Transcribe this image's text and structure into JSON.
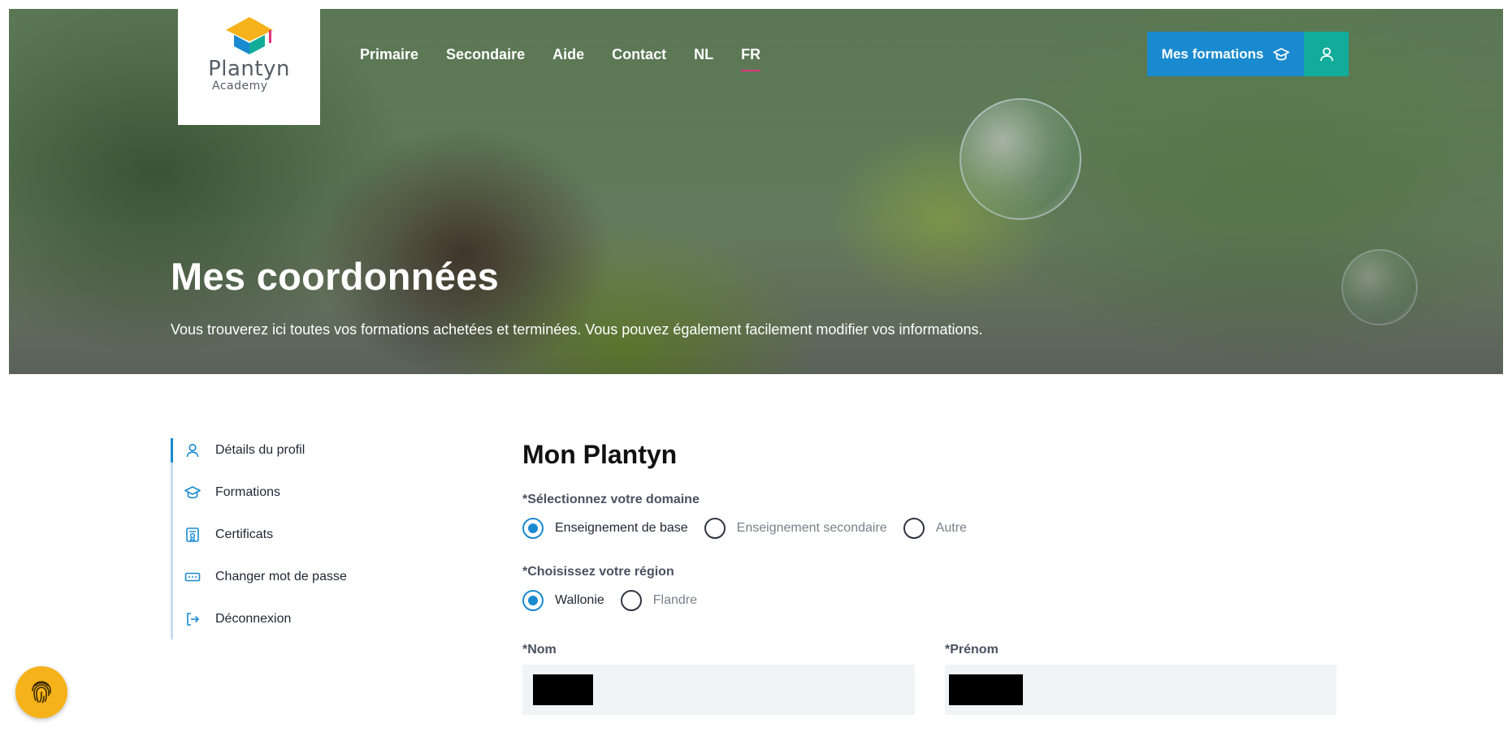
{
  "header": {
    "logo_name": "Plantyn",
    "logo_sub": "Academy",
    "nav": [
      {
        "label": "Primaire"
      },
      {
        "label": "Secondaire"
      },
      {
        "label": "Aide"
      },
      {
        "label": "Contact"
      },
      {
        "label": "NL"
      },
      {
        "label": "FR",
        "active": true
      }
    ],
    "formations_button": "Mes formations",
    "user_icon": "user-icon",
    "formations_icon": "graduation-cap-icon"
  },
  "hero": {
    "title": "Mes coordonnées",
    "subtitle": "Vous trouverez ici toutes vos formations achetées et terminées. Vous pouvez également facilement modifier vos informations."
  },
  "sidebar": {
    "items": [
      {
        "label": "Détails du profil",
        "icon": "user-icon",
        "active": true
      },
      {
        "label": "Formations",
        "icon": "graduation-cap-icon"
      },
      {
        "label": "Certificats",
        "icon": "certificate-icon"
      },
      {
        "label": "Changer mot de passe",
        "icon": "password-icon"
      },
      {
        "label": "Déconnexion",
        "icon": "logout-icon"
      }
    ]
  },
  "main": {
    "title": "Mon Plantyn",
    "domain": {
      "label": "*Sélectionnez votre domaine",
      "options": [
        "Enseignement de base",
        "Enseignement secondaire",
        "Autre"
      ],
      "selected": "Enseignement de base"
    },
    "region": {
      "label": "*Choisissez votre région",
      "options": [
        "Wallonie",
        "Flandre"
      ],
      "selected": "Wallonie"
    },
    "nom": {
      "label": "*Nom"
    },
    "prenom": {
      "label": "*Prénom"
    }
  },
  "colors": {
    "accent": "#1a8ad0",
    "teal": "#12ad9a",
    "nav_active_underline": "#e3337f",
    "fab": "#f6b21a"
  },
  "fab": {
    "icon": "fingerprint-icon"
  }
}
